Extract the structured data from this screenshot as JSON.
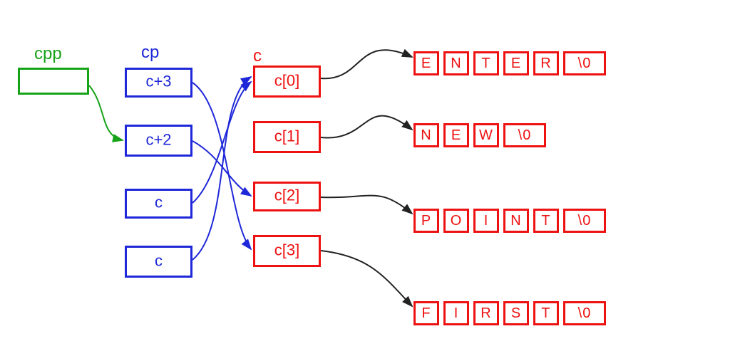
{
  "labels": {
    "cpp": "cpp",
    "cp": "cp",
    "c": "c"
  },
  "cp_box": {
    "0": "c+3",
    "1": "c+2",
    "2": "c",
    "3": "c"
  },
  "c_box": {
    "0": "c[0]",
    "1": "c[1]",
    "2": "c[2]",
    "3": "c[3]"
  },
  "strings": {
    "row0": [
      "E",
      "N",
      "T",
      "E",
      "R",
      "\\0"
    ],
    "row1": [
      "N",
      "E",
      "W",
      "\\0"
    ],
    "row2": [
      "P",
      "O",
      "I",
      "N",
      "T",
      "\\0"
    ],
    "row3": [
      "F",
      "I",
      "R",
      "S",
      "T",
      "\\0"
    ]
  },
  "pointers": {
    "cpp_to": "cp",
    "cp_mapping": [
      {
        "from": "cp[0]",
        "value": "c+3",
        "to": "c[3]"
      },
      {
        "from": "cp[1]",
        "value": "c+2",
        "to": "c[2]"
      },
      {
        "from": "cp[2]",
        "value": "c",
        "to": "c[0]"
      },
      {
        "from": "cp[3]",
        "value": "c",
        "to": "c[0]"
      }
    ],
    "c_mapping": [
      {
        "from": "c[0]",
        "to_string": "ENTER"
      },
      {
        "from": "c[1]",
        "to_string": "NEW"
      },
      {
        "from": "c[2]",
        "to_string": "POINT"
      },
      {
        "from": "c[3]",
        "to_string": "FIRST"
      }
    ]
  },
  "colors": {
    "green": "#16a318",
    "blue": "#1f28d8",
    "red": "#e11d1d",
    "black": "#222"
  }
}
